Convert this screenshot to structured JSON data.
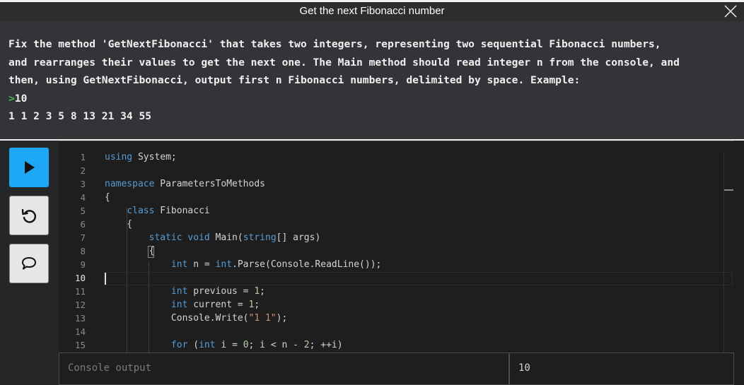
{
  "window": {
    "title": "Get the next Fibonacci number",
    "close_icon": "close-icon"
  },
  "task": {
    "line1": "Fix the method 'GetNextFibonacci' that takes two integers, representing two sequential Fibonacci numbers,",
    "line2": "and rearranges their values to get the next one. The Main method should read integer n from the console, and",
    "line3": "then, using GetNextFibonacci, output first n Fibonacci numbers, delimited by space. Example:",
    "prompt_symbol": ">",
    "example_input": "10",
    "example_output": "1 1 2 3 5 8 13 21 34 55"
  },
  "sidebar": {
    "run_icon": "play-icon",
    "reset_icon": "reset-icon",
    "hint_icon": "speech-bubble-icon"
  },
  "editor": {
    "active_line": 10,
    "line_numbers": [
      "1",
      "2",
      "3",
      "4",
      "5",
      "6",
      "7",
      "8",
      "9",
      "10",
      "11",
      "12",
      "13",
      "14",
      "15"
    ],
    "lines": [
      "using System;",
      "",
      "namespace ParametersToMethods",
      "{",
      "    class Fibonacci",
      "    {",
      "        static void Main(string[] args)",
      "        {",
      "            int n = int.Parse(Console.ReadLine());",
      "",
      "            int previous = 1;",
      "            int current = 1;",
      "            Console.Write(\"1 1\");",
      "",
      "            for (int i = 0; i < n - 2; ++i)"
    ]
  },
  "console": {
    "placeholder": "Console output",
    "input_value": "10"
  },
  "colors": {
    "run_button": "#1ea7f5",
    "keyword": "#569cd6",
    "string": "#ce9178",
    "number": "#b5cea8",
    "prompt": "#3fb950"
  }
}
